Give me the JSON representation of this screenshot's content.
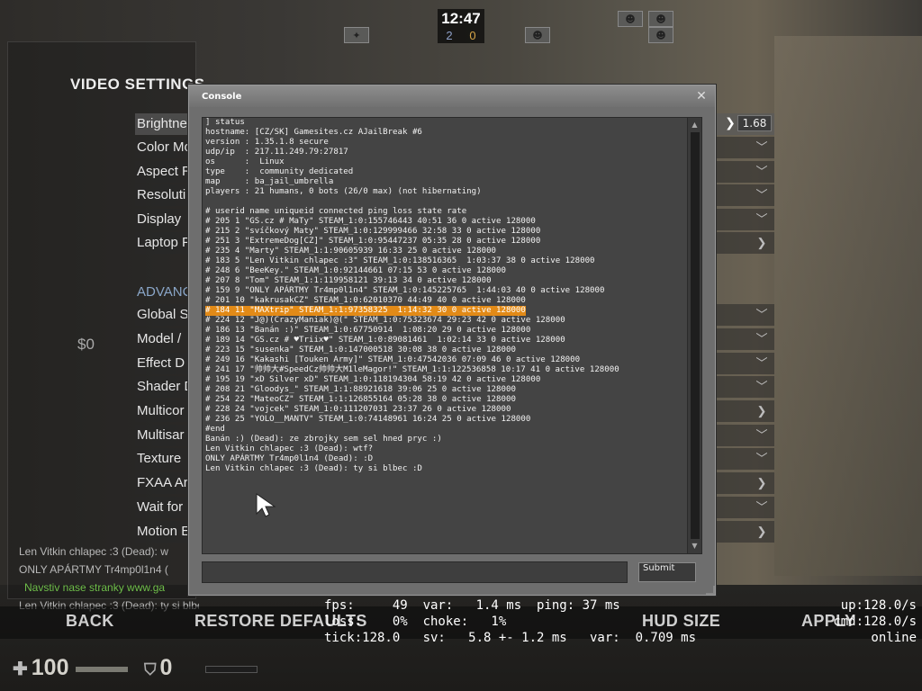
{
  "hud": {
    "time": "12:47",
    "score_ct": "2",
    "score_t": "0"
  },
  "menu": {
    "title": "VIDEO SETTINGS",
    "rows": [
      "Brightne",
      "Color Mo",
      "Aspect R",
      "Resoluti",
      "Display",
      "Laptop P"
    ],
    "section": "ADVANC",
    "adv_rows": [
      "Global S",
      "Model /",
      "Effect D",
      "Shader D",
      "Multicor",
      "Multisar",
      "Texture",
      "FXAA Ar",
      "Wait for",
      "Motion E"
    ],
    "brightness_value": "1.68",
    "money": "$0"
  },
  "chatlog": {
    "line1": "Len Vitkin chlapec :3 (Dead): w",
    "line2": "ONLY APÁRTMY Tr4mp0l1n4 (",
    "line3_prefix": "Navstiv nase stranky ",
    "line3_link": "www.ga",
    "line4": "Len Vitkin chlapec :3 (Dead): ty si blbec :D"
  },
  "bottom": {
    "back": "BACK",
    "restore": "RESTORE DEFAULTS",
    "hud_size": "HUD SIZE",
    "apply": "APPLY"
  },
  "netgraph": {
    "line1": "fps:     49  var:   1.4 ms  ping: 37 ms",
    "line2": "loss:    0%  choke:   1%",
    "line3": "tick:128.0   sv:   5.8 +- 1.2 ms   var:  0.709 ms",
    "r1": "up:128.0/s",
    "r2": "cmd:128.0/s",
    "r3": "online"
  },
  "player": {
    "health": "100",
    "armor": "0"
  },
  "console": {
    "title": "Console",
    "input_value": "",
    "submit_label": "Submit",
    "lines": [
      "] status",
      "hostname: [CZ/SK] Gamesites.cz AJailBreak #6",
      "version : 1.35.1.8 secure",
      "udp/ip  : 217.11.249.79:27817",
      "os      :  Linux",
      "type    :  community dedicated",
      "map     : ba_jail_umbrella",
      "players : 21 humans, 0 bots (26/0 max) (not hibernating)",
      "",
      "# userid name uniqueid connected ping loss state rate",
      "# 205 1 \"GS.cz # MaTy\" STEAM_1:0:155746443 40:51 36 0 active 128000",
      "# 215 2 \"svíčkový Maty\" STEAM_1:0:129999466 32:58 33 0 active 128000",
      "# 251 3 \"ExtremeDog[CZ]\" STEAM_1:0:95447237 05:35 28 0 active 128000",
      "# 235 4 \"Marty\" STEAM_1:1:90605939 16:33 25 0 active 128000",
      "# 183 5 \"Len Vitkin chlapec :3\" STEAM_1:0:138516365  1:03:37 38 0 active 128000",
      "# 248 6 \"BeeKey.\" STEAM_1:0:92144661 07:15 53 0 active 128000",
      "# 207 8 \"Tom\" STEAM_1:1:119958121 39:13 34 0 active 128000",
      "# 159 9 \"ONLY APÁRTMY Tr4mp0l1n4\" STEAM_1:0:145225765  1:44:03 40 0 active 128000",
      "# 201 10 \"kakrusakCZ\" STEAM_1:0:62010370 44:49 40 0 active 128000",
      "# 184 11 \"MAXtrip\" STEAM_1:1:97358325  1:14:32 30 0 active 128000",
      "# 224 12 \"J@)(CrazyManiak)@(\" STEAM_1:0:75323674 29:23 42 0 active 128000",
      "# 186 13 \"Banán :)\" STEAM_1:0:67750914  1:08:20 29 0 active 128000",
      "# 189 14 \"GS.cz # ♥Triix♥\" STEAM_1:0:89081461  1:02:14 33 0 active 128000",
      "# 223 15 \"susenka\" STEAM_1:0:147000518 30:08 38 0 active 128000",
      "# 249 16 \"Kakashi [Touken Army]\" STEAM_1:0:47542036 07:09 46 0 active 128000",
      "# 241 17 \"帅帅大#SpeedCz帅帅大M1leMagor!\" STEAM_1:1:122536858 10:17 41 0 active 128000",
      "# 195 19 \"xD Silver xD\" STEAM_1:0:118194304 58:19 42 0 active 128000",
      "# 208 21 \"Gloodys_\" STEAM_1:1:88921618 39:06 25 0 active 128000",
      "# 254 22 \"MateoCZ\" STEAM_1:1:126855164 05:28 38 0 active 128000",
      "# 228 24 \"vojcek\" STEAM_1:0:111207031 23:37 26 0 active 128000",
      "# 236 25 \"YOLO__MANTV\" STEAM_1:0:74148961 16:24 25 0 active 128000",
      "#end",
      "Banán :) (Dead): ze zbrojky sem sel hned pryc :)",
      "Len Vitkin chlapec :3 (Dead): wtf?",
      "ONLY APÁRTMY Tr4mp0l1n4 (Dead): :D",
      "Len Vitkin chlapec :3 (Dead): ty si blbec :D"
    ],
    "highlight_index": 19
  }
}
